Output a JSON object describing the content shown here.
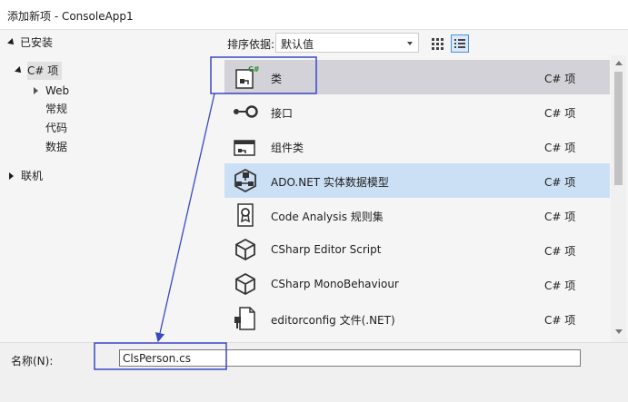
{
  "window": {
    "title": "添加新项 - ConsoleApp1"
  },
  "sidebar": {
    "installed": "已安装",
    "csharp": "C# 项",
    "children": [
      "Web",
      "常规",
      "代码",
      "数据"
    ],
    "online": "联机"
  },
  "sortbar": {
    "label": "排序依据:",
    "value": "默认值"
  },
  "items": [
    {
      "name": "类",
      "lang": "C# 项",
      "icon": "class-icon"
    },
    {
      "name": "接口",
      "lang": "C# 项",
      "icon": "interface-icon"
    },
    {
      "name": "组件类",
      "lang": "C# 项",
      "icon": "component-class-icon"
    },
    {
      "name": "ADO.NET 实体数据模型",
      "lang": "C# 项",
      "icon": "entity-model-icon"
    },
    {
      "name": "Code Analysis 规则集",
      "lang": "C# 项",
      "icon": "ruleset-icon"
    },
    {
      "name": "CSharp Editor Script",
      "lang": "C# 项",
      "icon": "cube-icon"
    },
    {
      "name": "CSharp MonoBehaviour",
      "lang": "C# 项",
      "icon": "cube-icon"
    },
    {
      "name": "editorconfig 文件(.NET)",
      "lang": "C# 项",
      "icon": "config-file-icon"
    }
  ],
  "namefield": {
    "label": "名称(N):",
    "value": "ClsPerson.cs"
  },
  "colors": {
    "annotation": "#3b48c4",
    "selected_gray": "#d2d2d8",
    "selected_blue": "#cce0f5"
  }
}
